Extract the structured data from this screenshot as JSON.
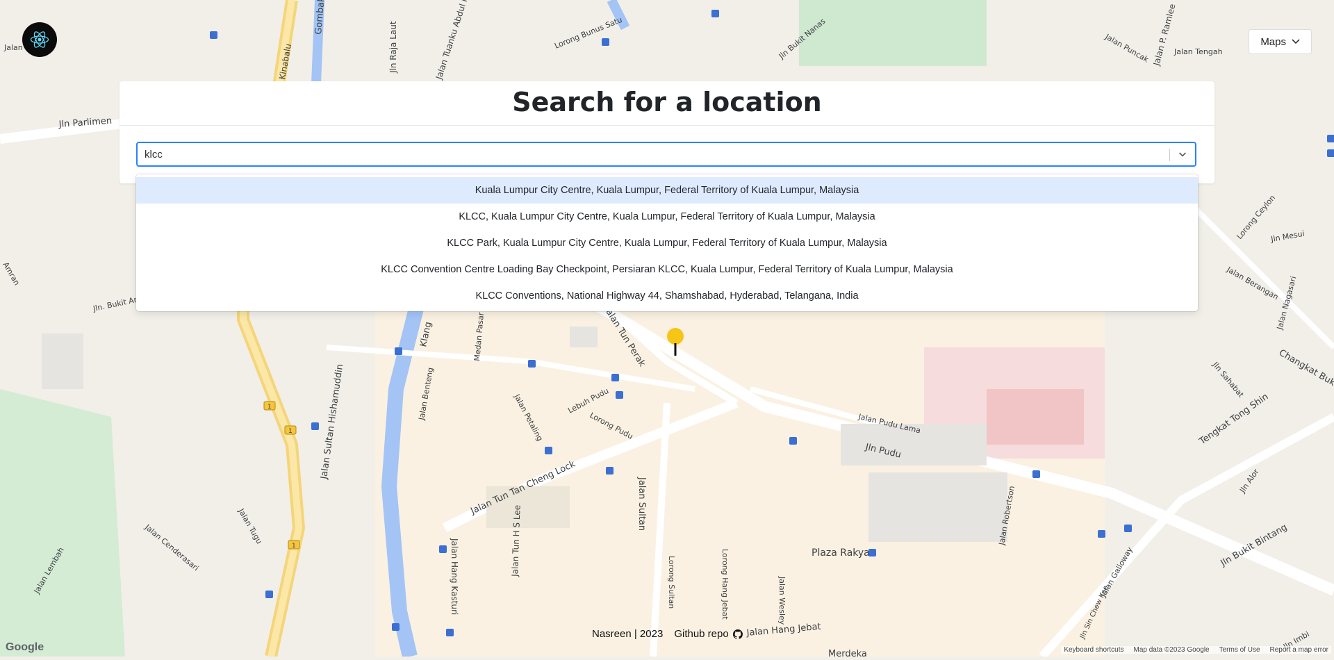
{
  "map": {
    "street_labels": [
      "Jln Parlimen",
      "Jalan Tun Perak",
      "Jln Pudu",
      "Jalan Pudu Lama",
      "Jalan Tun Tan Cheng Lock",
      "Jalan Sultan",
      "Jalan Hang Kasturi",
      "Jalan Tun H S Lee",
      "Jalan Petaling",
      "Lebuh Pudu",
      "Lorong Pudu",
      "Jalan Sultan Hishamuddin",
      "Jln. Bukit Aman",
      "Jalan Tugu",
      "Jalan Cenderasari",
      "Jalan Lembah",
      "Jalan Benteng",
      "Jalan Hang Jebat",
      "Lorong Hang Jebat",
      "Lorong Sultan",
      "Jalan Wesley",
      "Jalan Robertson",
      "Jln Bukit Bintang",
      "Tengkat Tong Shin",
      "Changkat Bukit",
      "Jln Sahabat",
      "Jalan Berangan",
      "Jalan Nagasari",
      "Jln Mesui",
      "Lorong Ceylon",
      "Jln Alor",
      "Jalan Galloway",
      "Jln Sin Chew Kee",
      "Jalan Tengah",
      "Jalan Puncak",
      "Jalan P. Ramlee",
      "Jln Bukit Nanas",
      "Jln Raja Laut",
      "Jalan Tuanku Abdul Rahman",
      "Lorong Bunus Satu",
      "Kinabalu",
      "Medan Pasar",
      "Klang",
      "Gombak",
      "Jln Imbi",
      "Jalan Ismail",
      "Amran"
    ],
    "place_label": "Plaza Rakyat",
    "place_label_2": "Merdeka",
    "road_shield": "1"
  },
  "header": {
    "maps_button_label": "Maps"
  },
  "search": {
    "title": "Search for a location",
    "input_value": "klcc",
    "options": [
      "Kuala Lumpur City Centre, Kuala Lumpur, Federal Territory of Kuala Lumpur, Malaysia",
      "KLCC, Kuala Lumpur City Centre, Kuala Lumpur, Federal Territory of Kuala Lumpur, Malaysia",
      "KLCC Park, Kuala Lumpur City Centre, Kuala Lumpur, Federal Territory of Kuala Lumpur, Malaysia",
      "KLCC Convention Centre Loading Bay Checkpoint, Persiaran KLCC, Kuala Lumpur, Federal Territory of Kuala Lumpur, Malaysia",
      "KLCC Conventions, National Highway 44, Shamshabad, Hyderabad, Telangana, India"
    ]
  },
  "footer": {
    "credit": "Nasreen | 2023",
    "repo_label": "Github repo"
  },
  "attribution": {
    "google": "Google",
    "keyboard": "Keyboard shortcuts",
    "map_data": "Map data ©2023 Google",
    "terms": "Terms of Use",
    "report": "Report a map error"
  },
  "colors": {
    "accent": "#2684ff",
    "option_focus": "#deebff",
    "pin": "#f5c518",
    "logo_bg": "#0b0b0b",
    "react_blue": "#61dafb"
  }
}
